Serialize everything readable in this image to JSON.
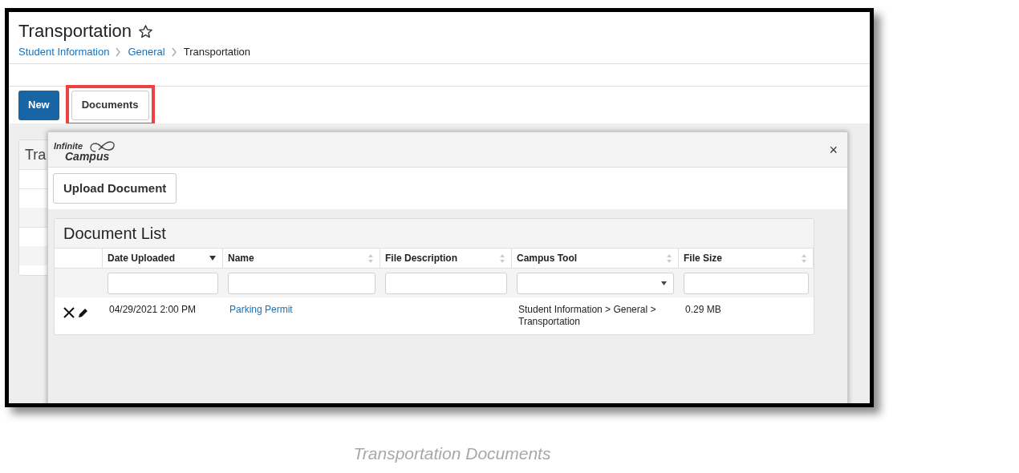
{
  "page": {
    "title": "Transportation",
    "favorite": false,
    "breadcrumbs": [
      {
        "label": "Student Information",
        "link": true
      },
      {
        "label": "General",
        "link": true
      },
      {
        "label": "Transportation",
        "link": false
      }
    ]
  },
  "toolbar": [
    {
      "label": "New",
      "kind": "primary",
      "highlighted": false
    },
    {
      "label": "Documents",
      "kind": "secondary",
      "highlighted": true
    }
  ],
  "background_panel": {
    "title": "Tra"
  },
  "modal": {
    "logo": {
      "line_1": "Infinite",
      "line_2": "Campus"
    },
    "close": "×",
    "upload_button": "Upload Document",
    "document_list": {
      "title": "Document List",
      "columns": [
        {
          "label": "Date Uploaded",
          "sorted": true,
          "kind": "text"
        },
        {
          "label": "Name",
          "sorted": false,
          "kind": "text"
        },
        {
          "label": "File Description",
          "sorted": false,
          "kind": "text"
        },
        {
          "label": "Campus Tool",
          "sorted": false,
          "kind": "select"
        },
        {
          "label": "File Size",
          "sorted": false,
          "kind": "text"
        }
      ],
      "rows": [
        {
          "date_uploaded": "04/29/2021 2:00 PM",
          "name": "Parking Permit",
          "campus_tool": "Student Information > General > Transportation",
          "file_size": "0.29 MB"
        }
      ]
    }
  },
  "caption": "Transportation Documents"
}
